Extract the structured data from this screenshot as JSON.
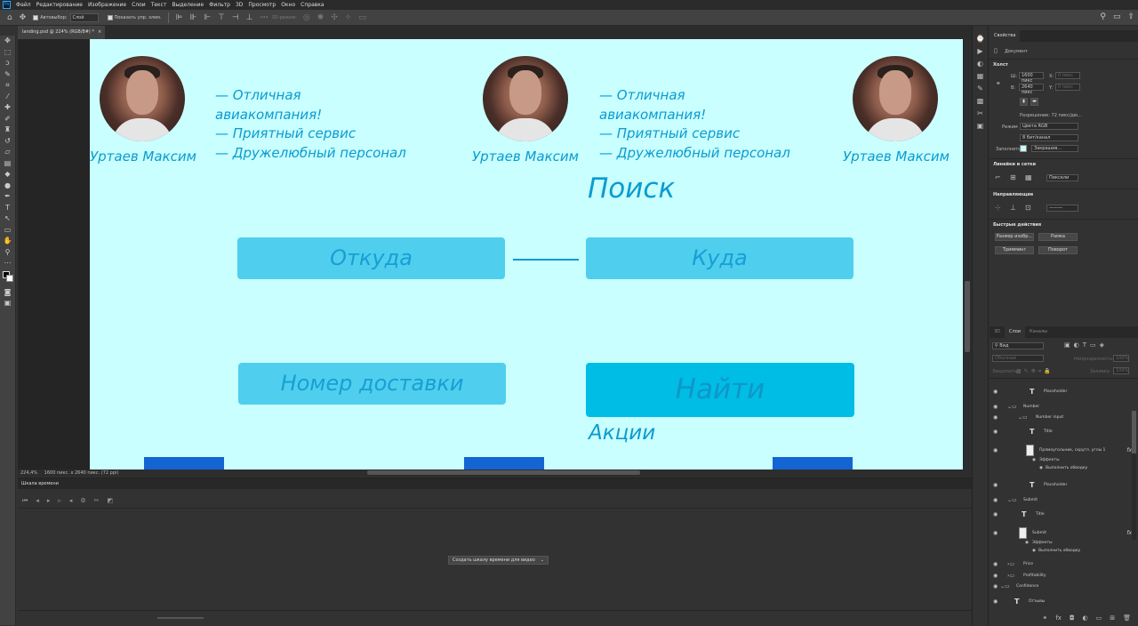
{
  "menu": [
    "Файл",
    "Редактирование",
    "Изображение",
    "Слои",
    "Текст",
    "Выделение",
    "Фильтр",
    "3D",
    "Просмотр",
    "Окно",
    "Справка"
  ],
  "options": {
    "autoselect_label": "Автовыбор:",
    "autoselect_value": "Слой",
    "show_controls_label": "Показать упр. элем.",
    "mode3d_label": "3D-режим:"
  },
  "document_tab": {
    "title": "landing.psd @ 224% (RGB/8#) *",
    "close": "×"
  },
  "artboard": {
    "reviews": [
      {
        "name": "Уртаев Максим"
      },
      {
        "name": "Уртаев Максим",
        "lines": [
          "— Отличная",
          "авиакомпания!",
          "— Приятный сервис",
          "— Дружелюбный персонал"
        ]
      },
      {
        "name": "Уртаев Максим"
      }
    ],
    "review_first": [
      "— Отличная",
      "авиакомпания!",
      "— Приятный сервис",
      "— Дружелюбный персонал"
    ],
    "search_title": "Поиск",
    "from_placeholder": "Откуда",
    "to_placeholder": "Куда",
    "delivery_placeholder": "Номер доставки",
    "find_button": "Найти",
    "promo_title": "Акции"
  },
  "status": {
    "zoom": "224,4%",
    "size": "1600 пикс. x 2640 пикс. (72 ppi)"
  },
  "timeline": {
    "title": "Шкала времени",
    "create_button": "Создать шкалу времени для видео"
  },
  "properties": {
    "tabs": [
      "Свойства"
    ],
    "doc_label": "Документ",
    "canvas_section": "Холст",
    "width_label": "Ш:",
    "width_value": "1600 пикс",
    "x_label": "X:",
    "x_value": "0 пикс",
    "height_label": "В:",
    "height_value": "2640 пикс",
    "y_label": "Y:",
    "y_value": "0 пикс",
    "resolution": "Разрешение: 72 пикс/дю...",
    "mode_label": "Режим",
    "mode_value": "Цвета RGB",
    "bits_value": "8 бит/канал",
    "fill_label": "Заполнить",
    "fill_value": "Закрашив...",
    "rulers_section": "Линейки и сетки",
    "rulers_unit": "Пиксели",
    "guides_section": "Направляющие",
    "quick_section": "Быстрые действия",
    "quick_buttons": [
      "Размер изобр...",
      "Рамка",
      "Тримминг",
      "Поворот"
    ]
  },
  "layers": {
    "tabs": [
      "3D",
      "Слои",
      "Каналы"
    ],
    "kind_label": "Вид",
    "blend_label": "Обычные",
    "opacity_label": "Непрозрачность:",
    "opacity_value": "100%",
    "lock_label": "Закрепить:",
    "fill_label": "Заливка:",
    "fill_value": "100%",
    "rows": [
      {
        "type": "text",
        "name": "Placeholder"
      },
      {
        "type": "group",
        "name": "Number"
      },
      {
        "type": "group",
        "name": "Number input"
      },
      {
        "type": "text",
        "name": "Title"
      },
      {
        "type": "shape",
        "name": "Прямоугольник, скругл. углы 1",
        "fx": "fx"
      },
      {
        "type": "sub",
        "name": "Эффекты"
      },
      {
        "type": "sub2",
        "name": "Выполнить обводку"
      },
      {
        "type": "text",
        "name": "Placeholder"
      },
      {
        "type": "group",
        "name": "Submit"
      },
      {
        "type": "text",
        "name": "Title"
      },
      {
        "type": "shape",
        "name": "Submit",
        "fx": "fx"
      },
      {
        "type": "sub",
        "name": "Эффекты"
      },
      {
        "type": "sub2",
        "name": "Выполнить обводку"
      },
      {
        "type": "group",
        "name": "Price"
      },
      {
        "type": "group",
        "name": "Profitability"
      },
      {
        "type": "group",
        "name": "Confidence"
      },
      {
        "type": "text",
        "name": "Отзывы"
      }
    ]
  },
  "colors": {
    "artboard_bg": "#c9ffff",
    "field": "#4fcfed",
    "button": "#00bde5",
    "text": "#0b9bd0"
  }
}
